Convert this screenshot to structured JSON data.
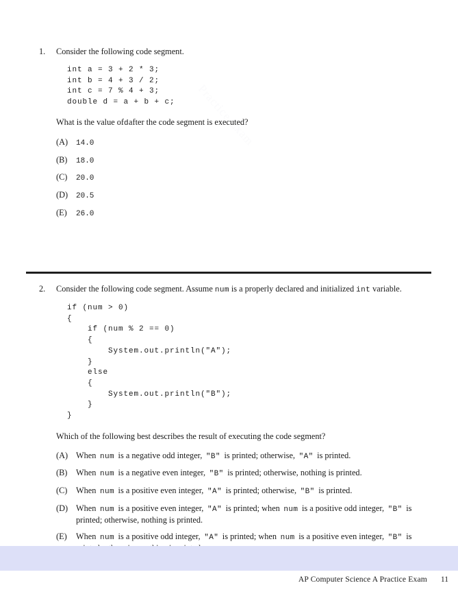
{
  "document": {
    "kind": "exam-page",
    "background_color": "#ffffff",
    "divider_color": "#191919",
    "footer_band_color": "#dde0f8"
  },
  "watermark": {
    "line1": "Practice Exam",
    "line2": "Practice Exam",
    "line3": "Practice Exam",
    "line4": "Practice Exam"
  },
  "questions": [
    {
      "number": "1.",
      "stem": "Consider the following code segment.",
      "code": "int a = 3 + 2 * 3;\nint b = 4 + 3 / 2;\nint c = 7 % 4 + 3;\ndouble d = a + b + c;",
      "prompt_before": "What is the value of",
      "prompt_mono": "d",
      "prompt_after": "after the code segment is executed?",
      "choices": [
        {
          "letter": "(A)",
          "text": "14.0",
          "mono": true
        },
        {
          "letter": "(B)",
          "text": "18.0",
          "mono": true
        },
        {
          "letter": "(C)",
          "text": "20.0",
          "mono": true
        },
        {
          "letter": "(D)",
          "text": "20.5",
          "mono": true
        },
        {
          "letter": "(E)",
          "text": "26.0",
          "mono": true
        }
      ]
    },
    {
      "number": "2.",
      "stem_part1": "Consider the following code segment. Assume",
      "stem_mono1": "num",
      "stem_part2": "is a properly declared and initialized",
      "stem_mono2": "int",
      "stem_part3": "variable.",
      "code": "if (num > 0)\n{\n    if (num % 2 == 0)\n    {\n        System.out.println(\"A\");\n    }\n    else\n    {\n        System.out.println(\"B\");\n    }\n}",
      "prompt": "Which of the following best describes the result of executing the code segment?",
      "choices": [
        {
          "letter": "(A)",
          "segments": [
            {
              "t": "When",
              "mono": false
            },
            {
              "t": "num",
              "mono": true
            },
            {
              "t": "is a negative odd integer,",
              "mono": false
            },
            {
              "t": "\"B\"",
              "mono": true
            },
            {
              "t": "is printed; otherwise,",
              "mono": false
            },
            {
              "t": "\"A\"",
              "mono": true
            },
            {
              "t": "is printed.",
              "mono": false
            }
          ]
        },
        {
          "letter": "(B)",
          "segments": [
            {
              "t": "When",
              "mono": false
            },
            {
              "t": "num",
              "mono": true
            },
            {
              "t": "is a negative even integer,",
              "mono": false
            },
            {
              "t": "\"B\"",
              "mono": true
            },
            {
              "t": "is printed; otherwise, nothing is printed.",
              "mono": false
            }
          ]
        },
        {
          "letter": "(C)",
          "segments": [
            {
              "t": "When",
              "mono": false
            },
            {
              "t": "num",
              "mono": true
            },
            {
              "t": "is a positive even integer,",
              "mono": false
            },
            {
              "t": "\"A\"",
              "mono": true
            },
            {
              "t": "is printed; otherwise,",
              "mono": false
            },
            {
              "t": "\"B\"",
              "mono": true
            },
            {
              "t": "is printed.",
              "mono": false
            }
          ]
        },
        {
          "letter": "(D)",
          "segments": [
            {
              "t": "When",
              "mono": false
            },
            {
              "t": "num",
              "mono": true
            },
            {
              "t": "is a positive even integer,",
              "mono": false
            },
            {
              "t": "\"A\"",
              "mono": true
            },
            {
              "t": "is printed; when",
              "mono": false
            },
            {
              "t": "num",
              "mono": true
            },
            {
              "t": "is a positive odd integer,",
              "mono": false
            },
            {
              "t": "\"B\"",
              "mono": true
            },
            {
              "t": "is printed; otherwise, nothing is printed.",
              "mono": false
            }
          ]
        },
        {
          "letter": "(E)",
          "segments": [
            {
              "t": "When",
              "mono": false
            },
            {
              "t": "num",
              "mono": true
            },
            {
              "t": "is a positive odd integer,",
              "mono": false
            },
            {
              "t": "\"A\"",
              "mono": true
            },
            {
              "t": "is printed; when",
              "mono": false
            },
            {
              "t": "num",
              "mono": true
            },
            {
              "t": "is a positive even integer,",
              "mono": false
            },
            {
              "t": "\"B\"",
              "mono": true
            },
            {
              "t": "is printed; otherwise, nothing is printed.",
              "mono": false
            }
          ]
        }
      ]
    }
  ],
  "footer": {
    "title": "AP Computer Science A Practice Exam",
    "page_number": "11"
  }
}
